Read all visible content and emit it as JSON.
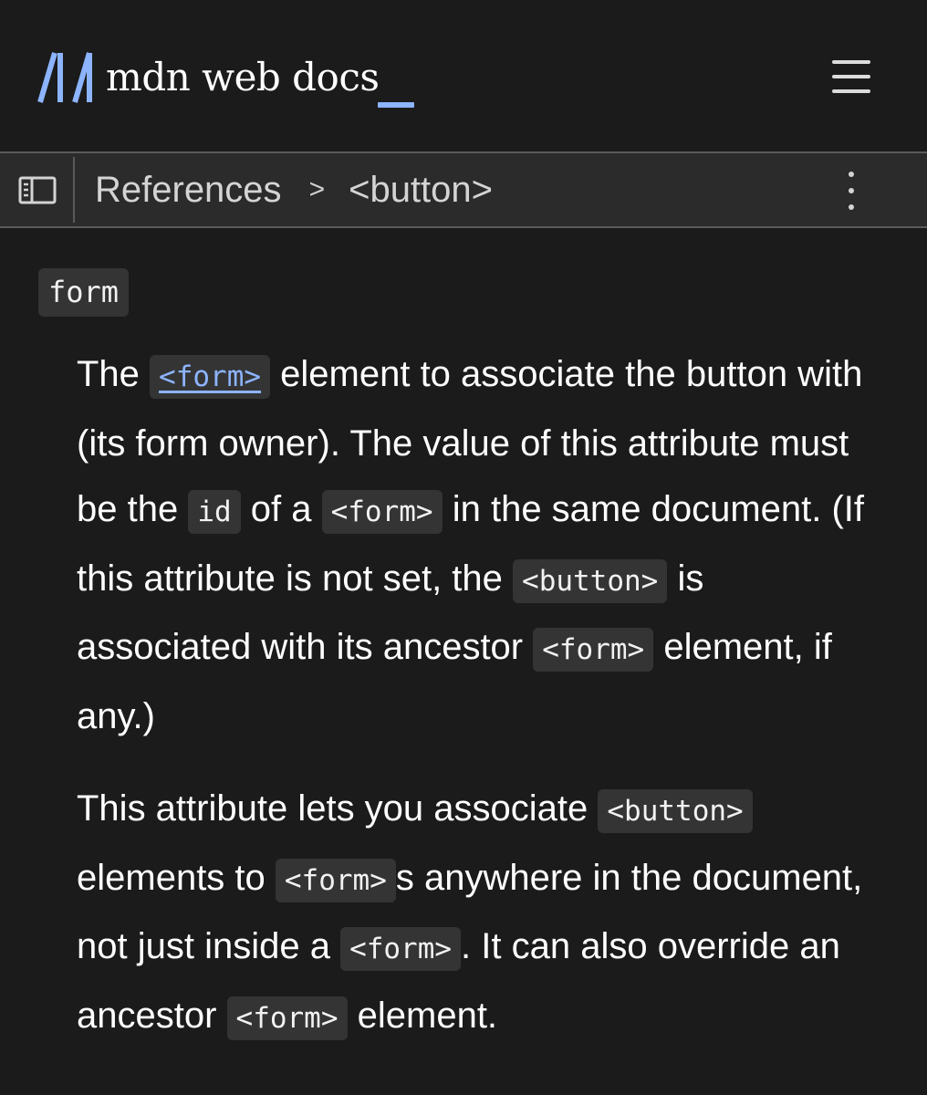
{
  "header": {
    "logo_text": "mdn web docs",
    "logo_cursor": "_"
  },
  "icons": {
    "logo": "mdn-logo-icon",
    "menu": "hamburger-menu-icon",
    "sidebar": "sidebar-toggle-icon",
    "crumb_separator": "chevron-right-icon",
    "more": "more-options-icon"
  },
  "breadcrumb": {
    "items": [
      "References",
      "<button>"
    ],
    "separator": ">"
  },
  "colors": {
    "background": "#1b1b1b",
    "bar": "#2b2b2b",
    "code_bg": "#343434",
    "accent": "#8cb4ff"
  },
  "content": {
    "term": "form",
    "para1": {
      "t1": "The ",
      "c1": "<form>",
      "t2": " element to associate the button with (its form owner). The value of this attribute must be the ",
      "c2": "id",
      "t3": " of a ",
      "c3": "<form>",
      "t4": " in the same document. (If this attribute is not set, the ",
      "c4": "<button>",
      "t5": " is associated with its ancestor ",
      "c5": "<form>",
      "t6": " element, if any.)"
    },
    "para2": {
      "t1": "This attribute lets you associate ",
      "c1": "<button>",
      "t2": " elements to ",
      "c2": "<form>",
      "t3": "s anywhere in the document, not just inside a ",
      "c3": "<form>",
      "t4": ". It can also override an ancestor ",
      "c4": "<form>",
      "t5": " element."
    }
  }
}
